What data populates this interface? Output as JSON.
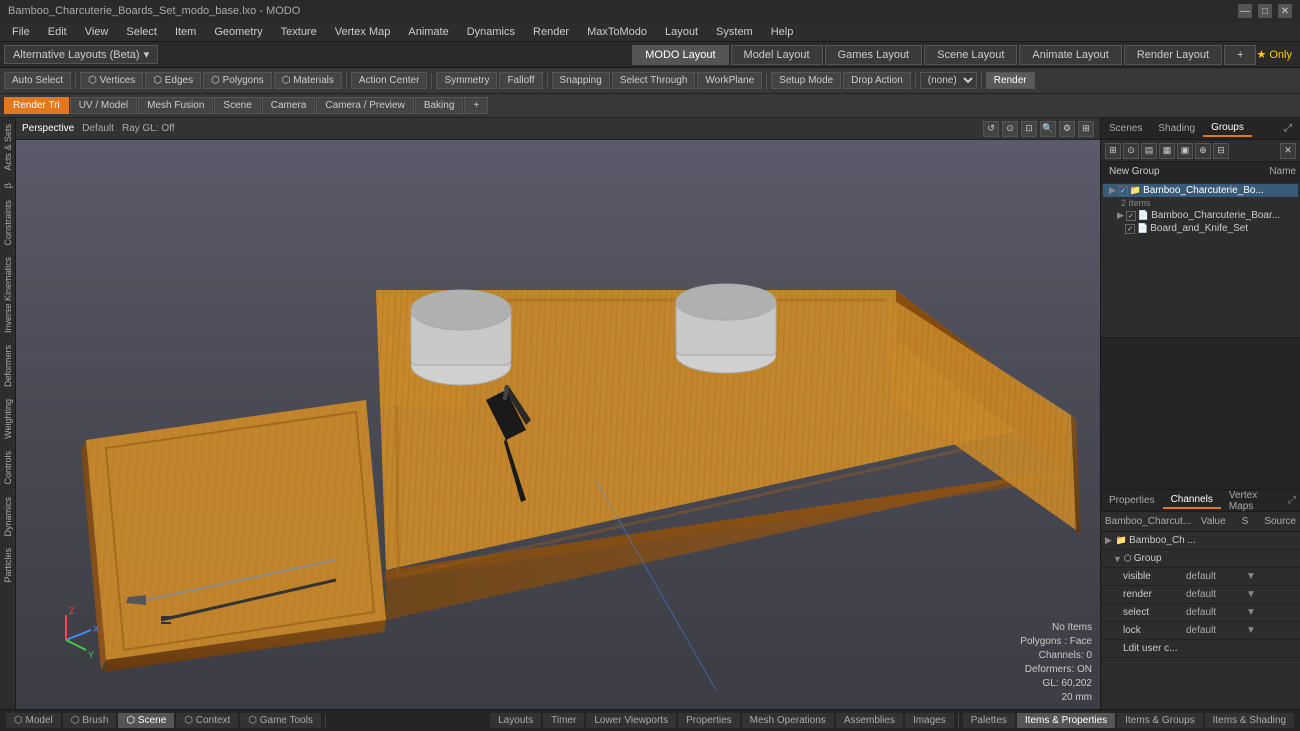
{
  "titlebar": {
    "title": "Bamboo_Charcuterie_Boards_Set_modo_base.lxo - MODO",
    "controls": [
      "—",
      "□",
      "✕"
    ]
  },
  "menubar": {
    "items": [
      "File",
      "Edit",
      "View",
      "Select",
      "Item",
      "Geometry",
      "Texture",
      "Vertex Map",
      "Animate",
      "Dynamics",
      "Render",
      "MaxToModo",
      "Layout",
      "System",
      "Help"
    ]
  },
  "layout_tabs": {
    "alt_layouts_label": "Alternative Layouts (Beta)",
    "tabs": [
      {
        "label": "MODO Layout",
        "active": true
      },
      {
        "label": "Model Layout",
        "active": false
      },
      {
        "label": "Games Layout",
        "active": false
      },
      {
        "label": "Scene Layout",
        "active": false
      },
      {
        "label": "Animate Layout",
        "active": false
      },
      {
        "label": "Render Layout",
        "active": false
      }
    ],
    "add_label": "+",
    "right_label": "★ Only"
  },
  "toolbar": {
    "buttons": [
      {
        "label": "Auto Select",
        "active": false
      },
      {
        "label": "Vertices",
        "active": false
      },
      {
        "label": "Edges",
        "active": false
      },
      {
        "label": "Polygons",
        "active": false
      },
      {
        "label": "Materials",
        "active": false
      },
      {
        "label": "⚙",
        "active": false
      },
      {
        "label": "◎",
        "active": false
      },
      {
        "label": "Action Center",
        "active": false
      },
      {
        "label": "| Symmetry",
        "active": false
      },
      {
        "label": "Falloff",
        "active": false
      },
      {
        "label": "| Snapping",
        "active": false
      },
      {
        "label": "Select Through",
        "active": false
      },
      {
        "label": "WorkPlane",
        "active": false
      },
      {
        "label": "Setup Mode",
        "active": false
      },
      {
        "label": "Drop Action",
        "active": false
      },
      {
        "label": "(none)",
        "active": false
      },
      {
        "label": "Render",
        "active": false
      }
    ]
  },
  "viewport_tabs": {
    "tabs": [
      {
        "label": "Render Tri",
        "active": true
      },
      {
        "label": "UV / Model",
        "active": false
      },
      {
        "label": "Mesh Fusion",
        "active": false
      },
      {
        "label": "Scene",
        "active": false
      },
      {
        "label": "Camera",
        "active": false
      },
      {
        "label": "Camera / Preview",
        "active": false
      },
      {
        "label": "Baking",
        "active": false
      },
      {
        "label": "+",
        "active": false
      }
    ]
  },
  "viewport": {
    "perspective_label": "Perspective",
    "default_label": "Default",
    "ray_gl_label": "Ray GL: Off",
    "info": {
      "no_items": "No Items",
      "polygons_face": "Polygons : Face",
      "channels_0": "Channels: 0",
      "deformers_on": "Deformers: ON",
      "gl_coords": "GL: 60,202",
      "zoom": "20 mm"
    }
  },
  "left_sidebar": {
    "tabs": [
      "Acts & Sets",
      "β",
      "Constraints",
      "Inverse Kinematics",
      "Deformers",
      "Weighting",
      "Controls",
      "Dynamics",
      "Particles"
    ]
  },
  "right_panel": {
    "top_tabs": [
      "Scenes",
      "Shading",
      "Groups"
    ],
    "active_top_tab": "Groups",
    "new_group_label": "New Group",
    "toolbar_icons": [
      "⊞",
      "⊟",
      "⊙",
      "⊕",
      "▤",
      "▦",
      "▣",
      "✕"
    ],
    "name_col_header": "Name",
    "tree": [
      {
        "indent": 0,
        "arrow": "▶",
        "icon": "📁",
        "checked": true,
        "label": "Bamboo_Charcuterie_Bo...",
        "selected": true
      },
      {
        "indent": 1,
        "arrow": "",
        "icon": "",
        "checked": false,
        "label": "2 Items"
      },
      {
        "indent": 1,
        "arrow": "▶",
        "icon": "📄",
        "checked": true,
        "label": "Bamboo_Charcuterie_Boar..."
      },
      {
        "indent": 2,
        "arrow": "",
        "icon": "📄",
        "checked": true,
        "label": "Board_and_Knife_Set"
      }
    ]
  },
  "channels_panel": {
    "tabs": [
      "Properties",
      "Channels",
      "Vertex Maps"
    ],
    "active_tab": "Channels",
    "expand_icon": "⤢",
    "header_cols": [
      "Bamboo_Charcut...",
      "Value",
      "S",
      "Source"
    ],
    "rows": [
      {
        "indent": 0,
        "arrow": "▶",
        "icon": "📁",
        "label": "Bamboo_Ch ...",
        "value": "",
        "source": ""
      },
      {
        "indent": 1,
        "arrow": "▼",
        "icon": "⬡",
        "label": "Group",
        "value": "",
        "source": ""
      },
      {
        "indent": 2,
        "arrow": "",
        "icon": "",
        "label": "visible",
        "value": "default",
        "source": "▼"
      },
      {
        "indent": 2,
        "arrow": "",
        "icon": "",
        "label": "render",
        "value": "default",
        "source": "▼"
      },
      {
        "indent": 2,
        "arrow": "",
        "icon": "",
        "label": "select",
        "value": "default",
        "source": "▼"
      },
      {
        "indent": 2,
        "arrow": "",
        "icon": "",
        "label": "lock",
        "value": "default",
        "source": "▼"
      },
      {
        "indent": 2,
        "arrow": "",
        "icon": "",
        "label": "Ldit user c...",
        "value": "",
        "source": ""
      }
    ]
  },
  "statusbar": {
    "tabs": [
      {
        "label": "Model",
        "active": false
      },
      {
        "label": "Brush",
        "active": false
      },
      {
        "label": "Scene",
        "active": true
      },
      {
        "label": "Context",
        "active": false
      },
      {
        "label": "Game Tools",
        "active": false
      }
    ],
    "right_tabs": [
      {
        "label": "Layouts"
      },
      {
        "label": "Timer"
      },
      {
        "label": "Lower Viewports"
      },
      {
        "label": "Properties"
      },
      {
        "label": "Mesh Operations"
      },
      {
        "label": "Assemblies"
      },
      {
        "label": "Images"
      }
    ],
    "far_right_tabs": [
      {
        "label": "Palettes"
      },
      {
        "label": "Items & Properties",
        "active": true
      },
      {
        "label": "Items & Groups"
      },
      {
        "label": "Items & Shading"
      }
    ]
  }
}
